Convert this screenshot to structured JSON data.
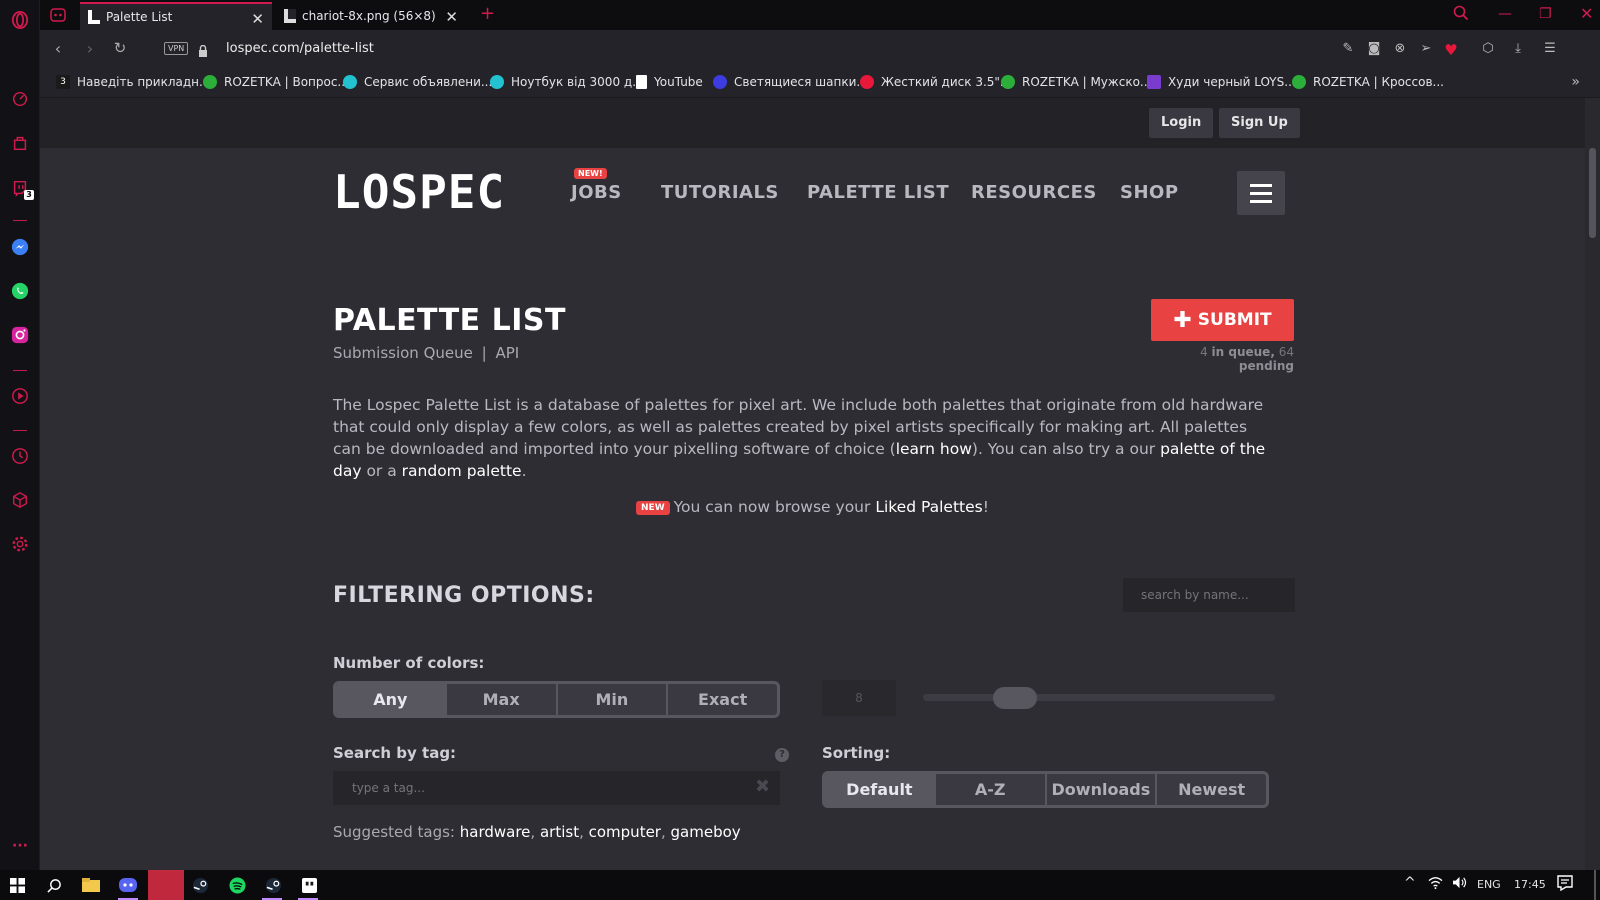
{
  "browser": {
    "tabs": [
      {
        "title": "Palette List",
        "active": true
      },
      {
        "title": "chariot-8x.png (56×8)",
        "active": false
      }
    ],
    "new_tab": "+",
    "vpn_label": "VPN",
    "url": "lospec.com/palette-list",
    "sidebar_badge": "3",
    "bookmarks": [
      {
        "label": "Наведіть прикладн...",
        "icon_color": "#1a1a1a",
        "icon_text": "3"
      },
      {
        "label": "ROZETKA | Вопрос...",
        "icon_color": "#2cae3a"
      },
      {
        "label": "Сервис объявлени...",
        "icon_color": "#23c2d0"
      },
      {
        "label": "Ноутбук від 3000 д...",
        "icon_color": "#23c2d0"
      },
      {
        "label": "YouTube",
        "icon_color": "#ffffff"
      },
      {
        "label": "Светящиеся шапки...",
        "icon_color": "#3c3ce0"
      },
      {
        "label": "Жесткий диск 3.5\"...",
        "icon_color": "#e8183b"
      },
      {
        "label": "ROZETKA | Мужско...",
        "icon_color": "#2cae3a"
      },
      {
        "label": "Худи черный LOYS...",
        "icon_color": "#7a3ccf"
      },
      {
        "label": "ROZETKA | Кроссов...",
        "icon_color": "#2cae3a"
      }
    ],
    "more_label": "»"
  },
  "site": {
    "login_label": "Login",
    "signup_label": "Sign Up",
    "logo_text": "LOSPEC",
    "nav": [
      {
        "label": "JOBS",
        "badge": "NEW!"
      },
      {
        "label": "TUTORIALS"
      },
      {
        "label": "PALETTE LIST"
      },
      {
        "label": "RESOURCES"
      },
      {
        "label": "SHOP"
      }
    ],
    "title": "PALETTE LIST",
    "sublinks": {
      "queue": "Submission Queue",
      "sep": "|",
      "api": "API"
    },
    "submit_label": "SUBMIT",
    "queue": {
      "in_queue_num": "4",
      "in_queue_label": "in queue,",
      "pending_num": "64",
      "pending_label": "pending"
    },
    "intro": {
      "p1": "The Lospec Palette List is a database of palettes for pixel art. We include both palettes that originate from old hardware that could only display a few colors, as well as palettes created by pixel artists specifically for making art. All palettes can be downloaded and imported into your pixelling software of choice (",
      "learn_how": "learn how",
      "p2": "). You can also try a our ",
      "potd": "palette of the day",
      "p3": " or a ",
      "random": "random palette",
      "p4": "."
    },
    "notice": {
      "badge": "NEW",
      "text": "You can now browse your ",
      "link": "Liked Palettes",
      "end": "!"
    },
    "filtering_title": "FILTERING OPTIONS:",
    "search_placeholder": "search by name...",
    "num_colors_label": "Number of colors:",
    "num_colors_options": [
      "Any",
      "Max",
      "Min",
      "Exact"
    ],
    "num_colors_selected": "Any",
    "num_value": "8",
    "slider_fraction": 0.2,
    "tag_label": "Search by tag:",
    "help_icon": "?",
    "tag_placeholder": "type a tag...",
    "sorting_label": "Sorting:",
    "sorting_options": [
      "Default",
      "A-Z",
      "Downloads",
      "Newest"
    ],
    "sorting_selected": "Default",
    "suggested_label": "Suggested tags:",
    "suggested_tags": [
      "hardware",
      "artist",
      "computer",
      "gameboy"
    ]
  },
  "taskbar": {
    "lang": "ENG",
    "time": "17:45"
  },
  "colors": {
    "accent": "#e84342",
    "opera_red": "#d11a4e",
    "page_bg": "#2f2d34"
  }
}
